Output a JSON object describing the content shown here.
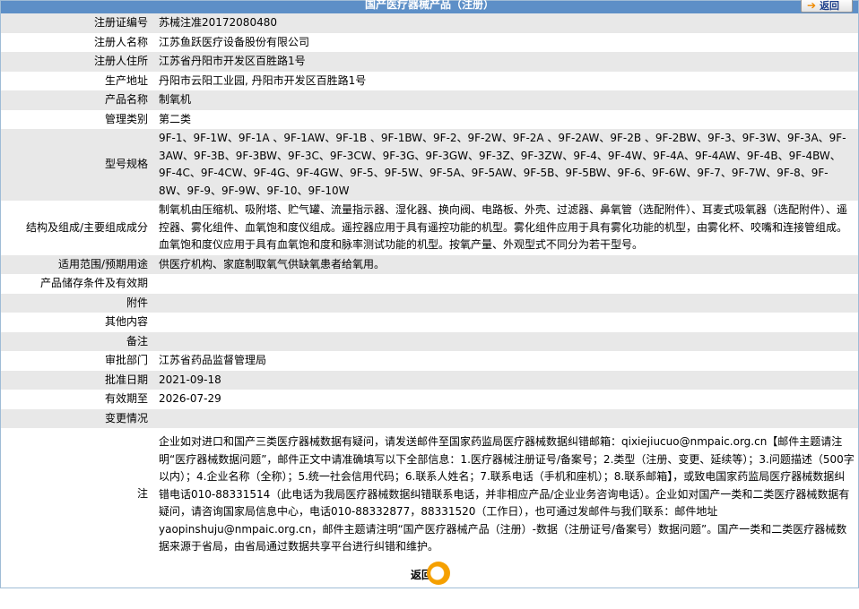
{
  "header": {
    "title": "国产医疗器械产品（注册）",
    "back_label": "返回"
  },
  "rows": [
    {
      "label": "注册证编号",
      "value": "苏械注准20172080480"
    },
    {
      "label": "注册人名称",
      "value": "江苏鱼跃医疗设备股份有限公司"
    },
    {
      "label": "注册人住所",
      "value": "江苏省丹阳市开发区百胜路1号"
    },
    {
      "label": "生产地址",
      "value": "丹阳市云阳工业园, 丹阳市开发区百胜路1号"
    },
    {
      "label": "产品名称",
      "value": "制氧机"
    },
    {
      "label": "管理类别",
      "value": "第二类"
    },
    {
      "label": "型号规格",
      "value": "9F-1、9F-1W、9F-1A 、9F-1AW、9F-1B 、9F-1BW、9F-2、9F-2W、9F-2A 、9F-2AW、9F-2B 、9F-2BW、9F-3、9F-3W、9F-3A、9F-3AW、9F-3B、9F-3BW、9F-3C、9F-3CW、9F-3G、9F-3GW、9F-3Z、9F-3ZW、9F-4、9F-4W、9F-4A、9F-4AW、9F-4B、9F-4BW、9F-4C、9F-4CW、9F-4G、9F-4GW、9F-5、9F-5W、9F-5A、9F-5AW、9F-5B、9F-5BW、9F-6、9F-6W、9F-7、9F-7W、9F-8、9F-8W、9F-9、9F-9W、9F-10、9F-10W"
    },
    {
      "label": "结构及组成/主要组成成分",
      "value": "制氧机由压缩机、吸附塔、贮气罐、流量指示器、湿化器、换向阀、电路板、外壳、过滤器、鼻氧管（选配附件）、耳麦式吸氧器（选配附件）、遥控器、雾化组件、血氧饱和度仪组成。遥控器应用于具有遥控功能的机型。雾化组件应用于具有雾化功能的机型，由雾化杯、咬嘴和连接管组成。血氧饱和度仪应用于具有血氧饱和度和脉率测试功能的机型。按氧产量、外观型式不同分为若干型号。"
    },
    {
      "label": "适用范围/预期用途",
      "value": "供医疗机构、家庭制取氧气供缺氧患者给氧用。"
    },
    {
      "label": "产品储存条件及有效期",
      "value": ""
    },
    {
      "label": "附件",
      "value": ""
    },
    {
      "label": "其他内容",
      "value": ""
    },
    {
      "label": "备注",
      "value": ""
    },
    {
      "label": "审批部门",
      "value": "江苏省药品监督管理局"
    },
    {
      "label": "批准日期",
      "value": "2021-09-18"
    },
    {
      "label": "有效期至",
      "value": "2026-07-29"
    },
    {
      "label": "变更情况",
      "value": ""
    }
  ],
  "note": {
    "label": "注",
    "text": "企业如对进口和国产三类医疗器械数据有疑问，请发送邮件至国家药监局医疗器械数据纠错邮箱：qixiejiucuo@nmpaic.org.cn【邮件主题请注明“医疗器械数据问题”，邮件正文中请准确填写以下全部信息：1.医疗器械注册证号/备案号；2.类型（注册、变更、延续等）；3.问题描述（500字以内）；4.企业名称（全称）；5.统一社会信用代码；6.联系人姓名；7.联系电话（手机和座机）；8.联系邮箱】，或致电国家药监局医疗器械数据纠错电话010-88331514（此电话为我局医疗器械数据纠错联系电话，并非相应产品/企业业务咨询电话）。企业如对国产一类和二类医疗器械数据有疑问，请咨询国家局信息中心，电话010-88332877，88331520（工作日），也可通过发邮件与我们联系：邮件地址yaopinshuju@nmpaic.org.cn，邮件主题请注明“国产医疗器械产品（注册）-数据（注册证号/备案号）数据问题”。国产一类和二类医疗器械数据来源于省局，由省局通过数据共享平台进行纠错和维护。"
  },
  "footer": {
    "back_label": "返回"
  }
}
